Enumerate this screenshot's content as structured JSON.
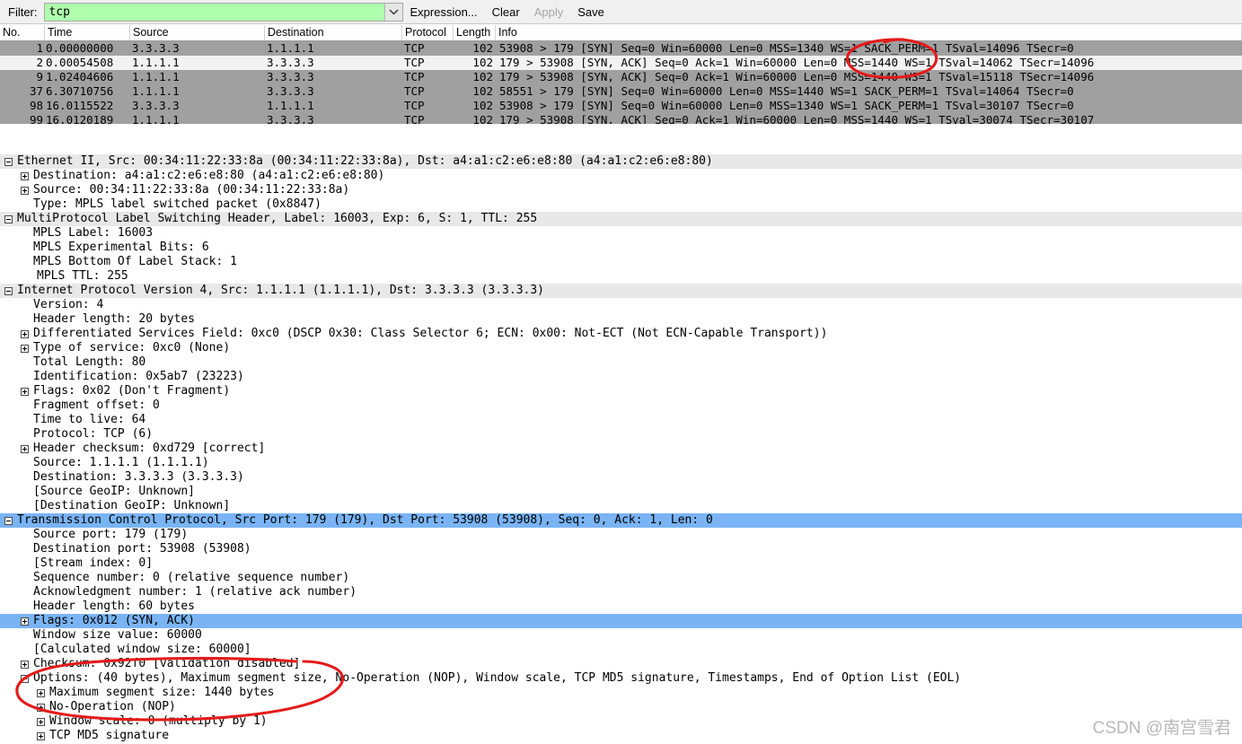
{
  "toolbar": {
    "filter_label": "Filter:",
    "filter_value": "tcp",
    "filter_placeholder": "",
    "expression_label": "Expression...",
    "clear_label": "Clear",
    "apply_label": "Apply",
    "save_label": "Save",
    "dropdown_icon": "chevron-down-icon",
    "filter_valid_color": "#afffaf"
  },
  "packet_list": {
    "columns": [
      "No.",
      "Time",
      "Source",
      "Destination",
      "Protocol",
      "Length",
      "Info"
    ],
    "rows": [
      {
        "no": "1",
        "time": "0.00000000",
        "source": "3.3.3.3",
        "destination": "1.1.1.1",
        "protocol": "TCP",
        "length": "102",
        "info": "53908 > 179 [SYN] Seq=0 Win=60000 Len=0 MSS=1340 WS=1 SACK_PERM=1 TSval=14096 TSecr=0"
      },
      {
        "no": "2",
        "time": "0.00054508",
        "source": "1.1.1.1",
        "destination": "3.3.3.3",
        "protocol": "TCP",
        "length": "102",
        "info": "179 > 53908 [SYN, ACK] Seq=0 Ack=1 Win=60000 Len=0 MSS=1440 WS=1 TSval=14062 TSecr=14096"
      },
      {
        "no": "9",
        "time": "1.02404606",
        "source": "1.1.1.1",
        "destination": "3.3.3.3",
        "protocol": "TCP",
        "length": "102",
        "info": "179 > 53908 [SYN, ACK] Seq=0 Ack=1 Win=60000 Len=0 MSS=1440 WS=1 TSval=15118 TSecr=14096"
      },
      {
        "no": "37",
        "time": "6.30710756",
        "source": "1.1.1.1",
        "destination": "3.3.3.3",
        "protocol": "TCP",
        "length": "102",
        "info": "58551 > 179 [SYN] Seq=0 Win=60000 Len=0 MSS=1440 WS=1 SACK_PERM=1 TSval=14064 TSecr=0"
      },
      {
        "no": "98",
        "time": "16.0115522",
        "source": "3.3.3.3",
        "destination": "1.1.1.1",
        "protocol": "TCP",
        "length": "102",
        "info": "53908 > 179 [SYN] Seq=0 Win=60000 Len=0 MSS=1340 WS=1 SACK_PERM=1 TSval=30107 TSecr=0"
      },
      {
        "no": "99",
        "time": "16.0120189",
        "source": "1.1.1.1",
        "destination": "3.3.3.3",
        "protocol": "TCP",
        "length": "102",
        "info": "179 > 53908 [SYN, ACK] Seq=0 Ack=1 Win=60000 Len=0 MSS=1440 WS=1 TSval=30074 TSecr=30107"
      }
    ]
  },
  "packet_detail": {
    "rows": [
      {
        "text": "Ethernet II, Src: 00:34:11:22:33:8a (00:34:11:22:33:8a), Dst: a4:a1:c2:e6:e8:80 (a4:a1:c2:e6:e8:80)"
      },
      {
        "text": "Destination: a4:a1:c2:e6:e8:80 (a4:a1:c2:e6:e8:80)"
      },
      {
        "text": "Source: 00:34:11:22:33:8a (00:34:11:22:33:8a)"
      },
      {
        "text": "Type: MPLS label switched packet (0x8847)"
      },
      {
        "text": "MultiProtocol Label Switching Header, Label: 16003, Exp: 6, S: 1, TTL: 255"
      },
      {
        "text": "MPLS Label: 16003"
      },
      {
        "text": "MPLS Experimental Bits: 6"
      },
      {
        "text": "MPLS Bottom Of Label Stack: 1"
      },
      {
        "text": "MPLS TTL: 255"
      },
      {
        "text": "Internet Protocol Version 4, Src: 1.1.1.1 (1.1.1.1), Dst: 3.3.3.3 (3.3.3.3)"
      },
      {
        "text": "Version: 4"
      },
      {
        "text": "Header length: 20 bytes"
      },
      {
        "text": "Differentiated Services Field: 0xc0 (DSCP 0x30: Class Selector 6; ECN: 0x00: Not-ECT (Not ECN-Capable Transport))"
      },
      {
        "text": "Type of service: 0xc0 (None)"
      },
      {
        "text": "Total Length: 80"
      },
      {
        "text": "Identification: 0x5ab7 (23223)"
      },
      {
        "text": "Flags: 0x02 (Don't Fragment)"
      },
      {
        "text": "Fragment offset: 0"
      },
      {
        "text": "Time to live: 64"
      },
      {
        "text": "Protocol: TCP (6)"
      },
      {
        "text": "Header checksum: 0xd729 [correct]"
      },
      {
        "text": "Source: 1.1.1.1 (1.1.1.1)"
      },
      {
        "text": "Destination: 3.3.3.3 (3.3.3.3)"
      },
      {
        "text": "[Source GeoIP: Unknown]"
      },
      {
        "text": "[Destination GeoIP: Unknown]"
      },
      {
        "text": "Transmission Control Protocol, Src Port: 179 (179), Dst Port: 53908 (53908), Seq: 0, Ack: 1, Len: 0"
      },
      {
        "text": "Source port: 179 (179)"
      },
      {
        "text": "Destination port: 53908 (53908)"
      },
      {
        "text": "[Stream index: 0]"
      },
      {
        "text": "Sequence number: 0    (relative sequence number)"
      },
      {
        "text": "Acknowledgment number: 1    (relative ack number)"
      },
      {
        "text": "Header length: 60 bytes"
      },
      {
        "text": "Flags: 0x012 (SYN, ACK)"
      },
      {
        "text": "Window size value: 60000"
      },
      {
        "text": "[Calculated window size: 60000]"
      },
      {
        "text": "Checksum: 0x92f0 [validation disabled]"
      },
      {
        "text": "Options: (40 bytes), Maximum segment size, No-Operation (NOP), Window scale, TCP MD5 signature, Timestamps, End of Option List (EOL)"
      },
      {
        "text": "Maximum segment size: 1440 bytes"
      },
      {
        "text": "No-Operation (NOP)"
      },
      {
        "text": "Window scale: 0 (multiply by 1)"
      },
      {
        "text": "TCP MD5 signature"
      }
    ]
  },
  "annotations": {
    "circle_top_target": "MSS=1440",
    "circle_bottom_target": "Options: (40 bytes), Maximum segment size",
    "color": "#e41b1b"
  },
  "watermark": {
    "text": "CSDN @南宫雪君"
  }
}
